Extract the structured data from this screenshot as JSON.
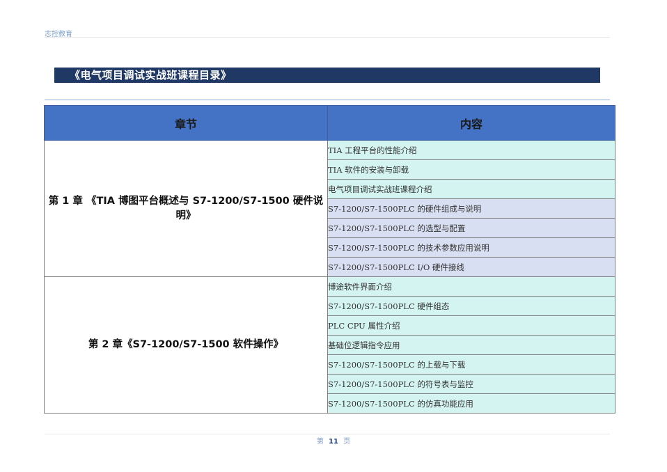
{
  "header": {
    "brand": "志控教育"
  },
  "title": "《电气项目调试实战班课程目录》",
  "table": {
    "columns": [
      "章节",
      "内容"
    ],
    "chapters": [
      {
        "title": "第 1 章 《TIA 博图平台概述与 S7-1200/S7-1500 硬件说明》",
        "items": [
          "TIA 工程平台的性能介绍",
          "TIA 软件的安装与卸载",
          "电气项目调试实战班课程介绍",
          "S7-1200/S7-1500PLC 的硬件组成与说明",
          "S7-1200/S7-1500PLC 的选型与配置",
          "S7-1200/S7-1500PLC 的技术参数应用说明",
          "S7-1200/S7-1500PLC I/O 硬件接线"
        ]
      },
      {
        "title": "第 2 章《S7-1200/S7-1500 软件操作》",
        "items": [
          "博途软件界面介绍",
          "S7-1200/S7-1500PLC 硬件组态",
          "PLC CPU 属性介绍",
          "基础位逻辑指令应用",
          "S7-1200/S7-1500PLC 的上载与下载",
          "S7-1200/S7-1500PLC 的符号表与监控",
          "S7-1200/S7-1500PLC 的仿真功能应用"
        ]
      }
    ]
  },
  "footer": {
    "prefix": "第",
    "page": "11",
    "suffix": "页"
  }
}
